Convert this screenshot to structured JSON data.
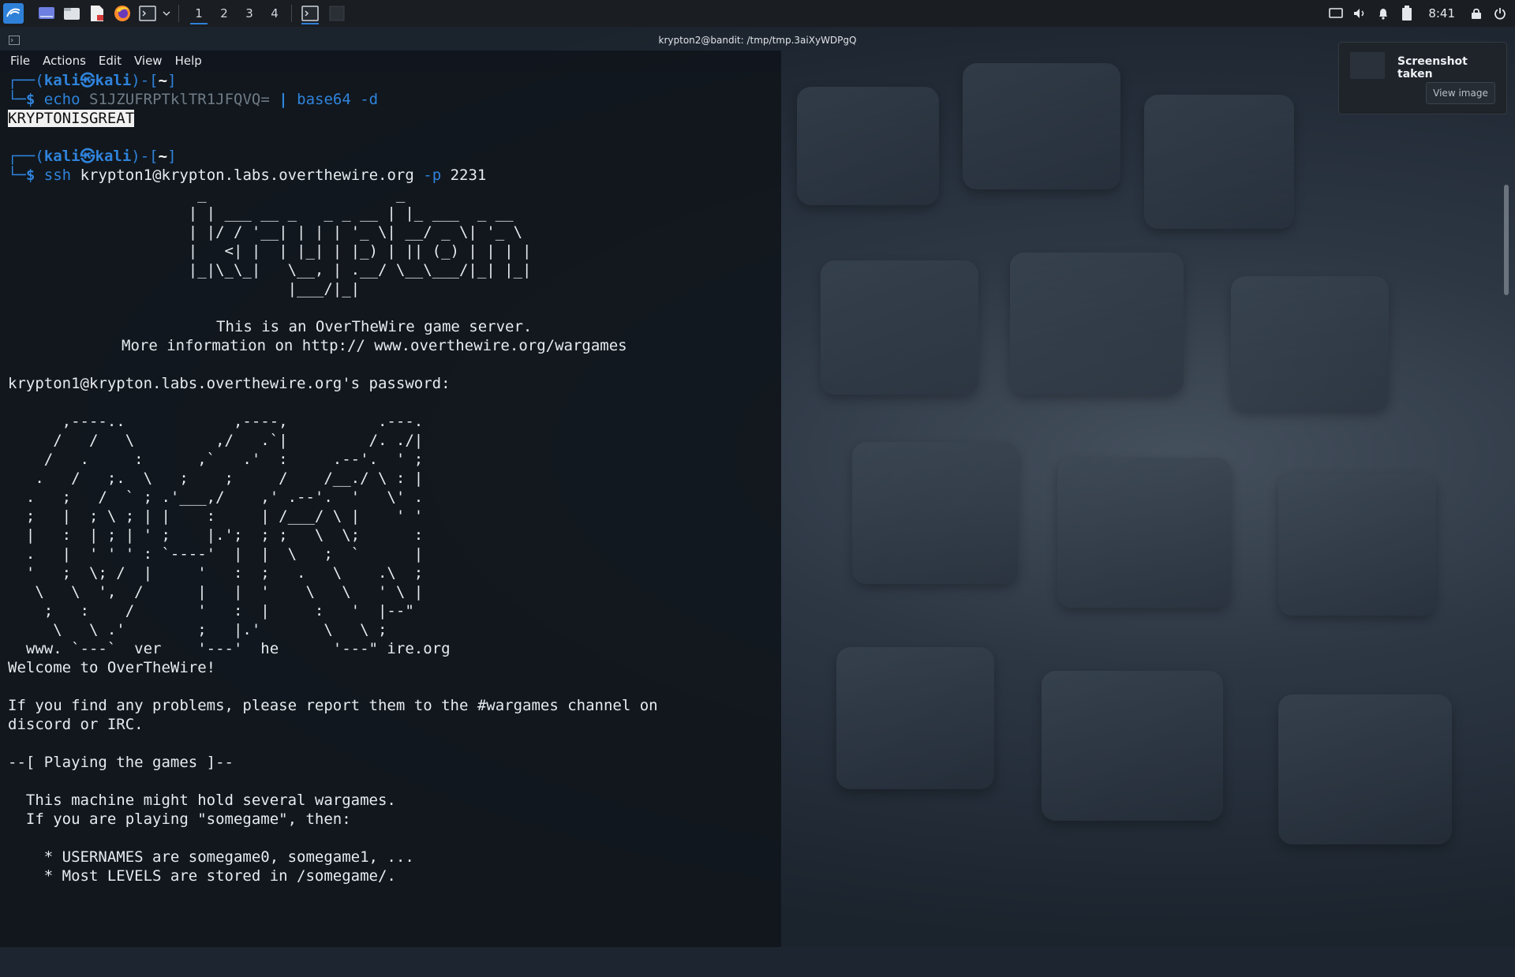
{
  "panel": {
    "workspaces": [
      "1",
      "2",
      "3",
      "4"
    ],
    "active_workspace": 0,
    "clock": "8:41"
  },
  "window": {
    "title": "krypton2@bandit: /tmp/tmp.3aiXyWDPgQ"
  },
  "menu": {
    "file": "File",
    "actions": "Actions",
    "edit": "Edit",
    "view": "View",
    "help": "Help"
  },
  "terminal": {
    "prompt1_user": "kali㉿kali",
    "prompt1_dir": "~",
    "cmd1_name": "echo",
    "cmd1_arg": "S1JZUFRPTklTR1JFQVQ=",
    "cmd1_pipe": "|",
    "cmd1_prog": "base64",
    "cmd1_flag": "-d",
    "output1": "KRYPTONISGREAT",
    "prompt2_user": "kali㉿kali",
    "prompt2_dir": "~",
    "cmd2_name": "ssh",
    "cmd2_target": "krypton1@krypton.labs.overthewire.org",
    "cmd2_flag": "-p",
    "cmd2_port": "2231",
    "banner_art": "                     _                     _\n                    | | ___ __ _   _ _ __ | |_ ___  _ __\n                    | |/ / '__| | | | '_ \\| __/ _ \\| '_ \\\n                    |   <| |  | |_| | |_) | || (_) | | | |\n                    |_|\\_\\_|   \\__, | .__/ \\__\\___/|_| |_|\n                               |___/|_|",
    "server_line1": "This is an OverTheWire game server.",
    "server_line2": "More information on http:// www.overthewire.org/wargames",
    "password_prompt": "krypton1@krypton.labs.overthewire.org's password:",
    "otw_art": "      ,----..            ,----,          .---.\n     /   /   \\         ,/   .`|         /. ./|\n    /   .     :      ,`   .'  :     .--'.  ' ;\n   .   /   ;.  \\   ;    ;     /    /__./ \\ : |\n  .   ;   /  ` ; .'___,/    ,' .--'.  '   \\' .\n  ;   |  ; \\ ; | |    :     | /___/ \\ |    ' '\n  |   :  | ; | ' ;    |.';  ; ;   \\  \\;      :\n  .   |  ' ' ' : `----'  |  |  \\   ;  `      |\n  '   ;  \\; /  |     '   :  ;   .   \\    .\\  ;\n   \\   \\  ',  /      |   |  '    \\   \\   ' \\ |\n    ;   :    /       '   :  |     :   '  |--\"\n     \\   \\ .'        ;   |.'       \\   \\ ;\n  www. `---`  ver    '---'  he      '---\" ire.org",
    "welcome": "Welcome to OverTheWire!",
    "problems_line1": "If you find any problems, please report them to the #wargames channel on",
    "problems_line2": "discord or IRC.",
    "section_header": "--[ Playing the games ]--",
    "games_line1": "  This machine might hold several wargames.",
    "games_line2": "  If you are playing \"somegame\", then:",
    "bullet1": "    * USERNAMES are somegame0, somegame1, ...",
    "bullet2": "    * Most LEVELS are stored in /somegame/."
  },
  "notification": {
    "title": "Screenshot taken",
    "button": "View image"
  },
  "colors": {
    "prompt_blue": "#2f83db",
    "terminal_bg": "#11161d",
    "panel_bg": "#1a1d22",
    "accent": "#2f81d8"
  }
}
